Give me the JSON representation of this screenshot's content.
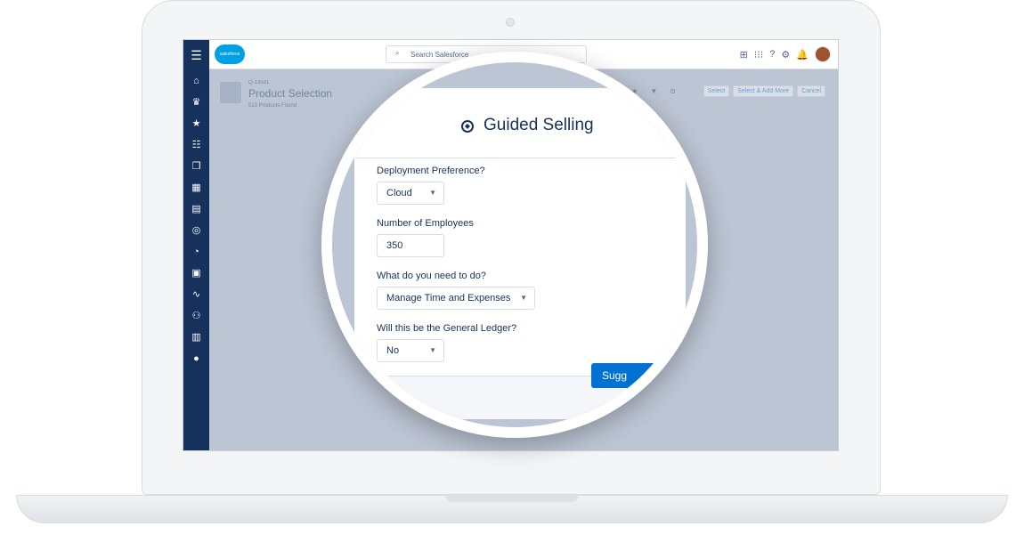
{
  "topbar": {
    "logo_text": "salesforce",
    "search_placeholder": "Search Salesforce"
  },
  "sidebar": {
    "items": [
      {
        "name": "menu-icon",
        "glyph": "☰"
      },
      {
        "name": "home-icon",
        "glyph": "⌂"
      },
      {
        "name": "crown-icon",
        "glyph": "♛"
      },
      {
        "name": "star-icon",
        "glyph": "★"
      },
      {
        "name": "tasks-icon",
        "glyph": "☷"
      },
      {
        "name": "documents-icon",
        "glyph": "❐"
      },
      {
        "name": "building-icon",
        "glyph": "▦"
      },
      {
        "name": "contact-card-icon",
        "glyph": "▤"
      },
      {
        "name": "target-icon",
        "glyph": "◎"
      },
      {
        "name": "dashboard-icon",
        "glyph": "◔"
      },
      {
        "name": "clipboard-icon",
        "glyph": "▣"
      },
      {
        "name": "pulse-icon",
        "glyph": "∿"
      },
      {
        "name": "people-icon",
        "glyph": "⚇"
      },
      {
        "name": "calendar-icon",
        "glyph": "▥"
      },
      {
        "name": "user-icon",
        "glyph": "●"
      }
    ]
  },
  "background_page": {
    "quote_id": "Q-13531",
    "title": "Product Selection",
    "count": "513 Products Found",
    "actions": [
      "Select",
      "Select & Add More",
      "Cancel"
    ]
  },
  "modal": {
    "title": "Guided Selling",
    "fields": [
      {
        "label": "Deployment Preference?",
        "value": "Cloud"
      },
      {
        "label": "Number of Employees",
        "value": "350"
      },
      {
        "label": "What do you need to do?",
        "value": "Manage Time and Expenses"
      },
      {
        "label": "Will this be the General Ledger?",
        "value": "No"
      }
    ],
    "suggest_label": "Sugg"
  },
  "colors": {
    "sidebar": "#16325c",
    "accent": "#0070d2",
    "brand_cloud": "#00a1e0"
  }
}
